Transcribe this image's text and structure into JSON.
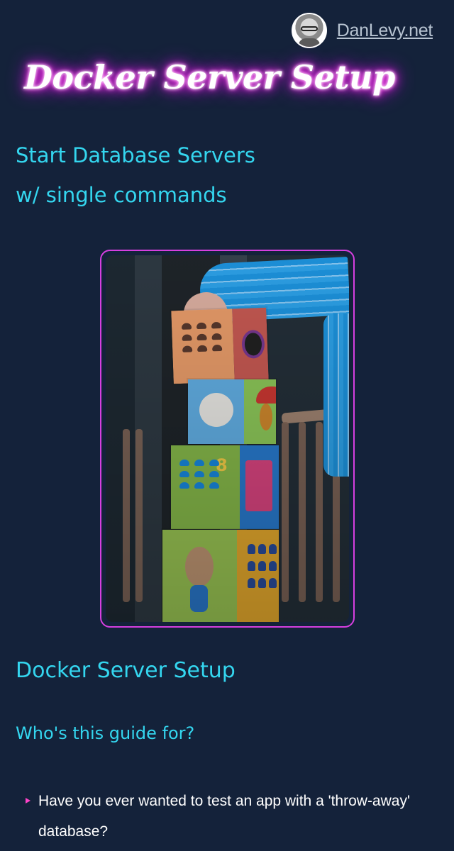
{
  "header": {
    "site_link": "DanLevy.net",
    "avatar_icon": "avatar-icon"
  },
  "hero": {
    "title": "Docker Server Setup",
    "subtitle_lines": [
      "Start Database Servers",
      "w/ single commands"
    ]
  },
  "image": {
    "alt": "Child stacking colorful toy blocks"
  },
  "content": {
    "section_title": "Docker Server Setup",
    "question": "Who's this guide for?",
    "list_items": [
      "Have you ever wanted to test an app with a 'throw-away' database?"
    ]
  },
  "colors": {
    "background": "#14223a",
    "accent": "#34d6ef",
    "neon": "#ff2ee8",
    "frame": "#d63fe0"
  }
}
